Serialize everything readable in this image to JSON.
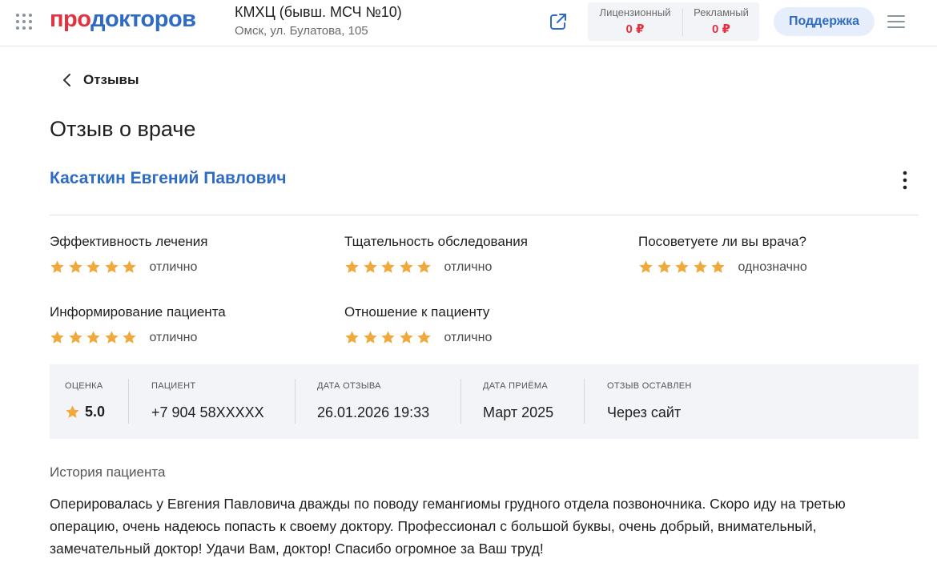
{
  "header": {
    "logo_part1": "про",
    "logo_part2": "докторов",
    "clinic_name": "КМХЦ (бывш. МСЧ №10)",
    "clinic_address": "Омск, ул. Булатова, 105",
    "prices": [
      {
        "label": "Лицензионный",
        "value": "0 ₽"
      },
      {
        "label": "Рекламный",
        "value": "0 ₽"
      }
    ],
    "support_label": "Поддержка",
    "icons": {
      "apps": "apps-grid-icon",
      "external": "external-link-icon",
      "menu": "hamburger-menu-icon"
    }
  },
  "nav": {
    "back_label": "Отзывы"
  },
  "page_title": "Отзыв о враче",
  "doctor_name": "Касаткин Евгений Павлович",
  "ratings": [
    {
      "label": "Эффективность лечения",
      "stars": 5,
      "word": "отлично"
    },
    {
      "label": "Тщательность обследования",
      "stars": 5,
      "word": "отлично"
    },
    {
      "label": "Посоветуете ли вы врача?",
      "stars": 5,
      "word": "однозначно"
    },
    {
      "label": "Информирование пациента",
      "stars": 5,
      "word": "отлично"
    },
    {
      "label": "Отношение к пациенту",
      "stars": 5,
      "word": "отлично"
    }
  ],
  "info": {
    "score_label": "Оценка",
    "score_value": "5.0",
    "patient_label": "Пациент",
    "patient_value": "+7 904 58XXXXX",
    "review_date_label": "Дата отзыва",
    "review_date_value": "26.01.2026 19:33",
    "visit_date_label": "Дата приёма",
    "visit_date_value": "Март 2025",
    "source_label": "Отзыв оставлен",
    "source_value": "Через сайт"
  },
  "story": {
    "title": "История пациента",
    "text": "Оперировалась у Евгения Павловича дважды по поводу гемангиомы грудного отдела позвоночника. Скоро иду на третью операцию, очень надеюсь попасть к своему доктору. Профессионал с большой буквы, очень добрый, внимательный, замечательный доктор! Удачи Вам, доктор! Спасибо огромное за Ваш труд!"
  },
  "colors": {
    "brand_red": "#e0333f",
    "brand_blue": "#2d6bc4",
    "star": "#f0a93b",
    "panel_bg": "#f2f4f7"
  }
}
